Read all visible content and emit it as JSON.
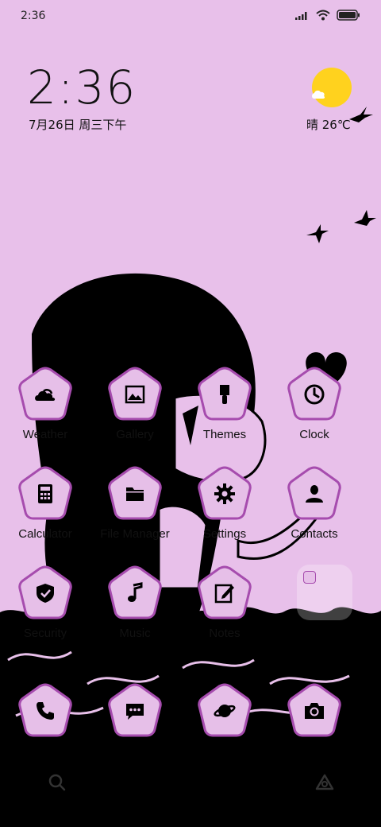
{
  "status_bar": {
    "time": "2:36"
  },
  "clock_widget": {
    "time": "2:36",
    "date": "7月26日 周三下午"
  },
  "weather_widget": {
    "text": "晴 26℃"
  },
  "apps": [
    {
      "id": "weather",
      "label": "Weather",
      "icon": "cloud-sun-icon"
    },
    {
      "id": "gallery",
      "label": "Gallery",
      "icon": "image-icon"
    },
    {
      "id": "themes",
      "label": "Themes",
      "icon": "paintbrush-icon"
    },
    {
      "id": "clock",
      "label": "Clock",
      "icon": "clock-icon"
    },
    {
      "id": "calculator",
      "label": "Calculator",
      "icon": "calculator-icon"
    },
    {
      "id": "file-manager",
      "label": "File Manager",
      "icon": "folder-icon"
    },
    {
      "id": "settings",
      "label": "Settings",
      "icon": "gear-icon"
    },
    {
      "id": "contacts",
      "label": "Contacts",
      "icon": "person-icon"
    },
    {
      "id": "security",
      "label": "Security",
      "icon": "shield-icon"
    },
    {
      "id": "music",
      "label": "Music",
      "icon": "music-note-icon"
    },
    {
      "id": "notes",
      "label": "Notes",
      "icon": "edit-icon"
    }
  ],
  "dock": [
    {
      "id": "phone",
      "icon": "phone-icon"
    },
    {
      "id": "messages",
      "icon": "chat-icon"
    },
    {
      "id": "browser",
      "icon": "planet-icon"
    },
    {
      "id": "camera",
      "icon": "camera-icon"
    }
  ],
  "colors": {
    "background": "#e8c0ea",
    "icon_fill": "#e6bfe8",
    "icon_stroke": "#a64cae",
    "silhouette": "#000000"
  }
}
